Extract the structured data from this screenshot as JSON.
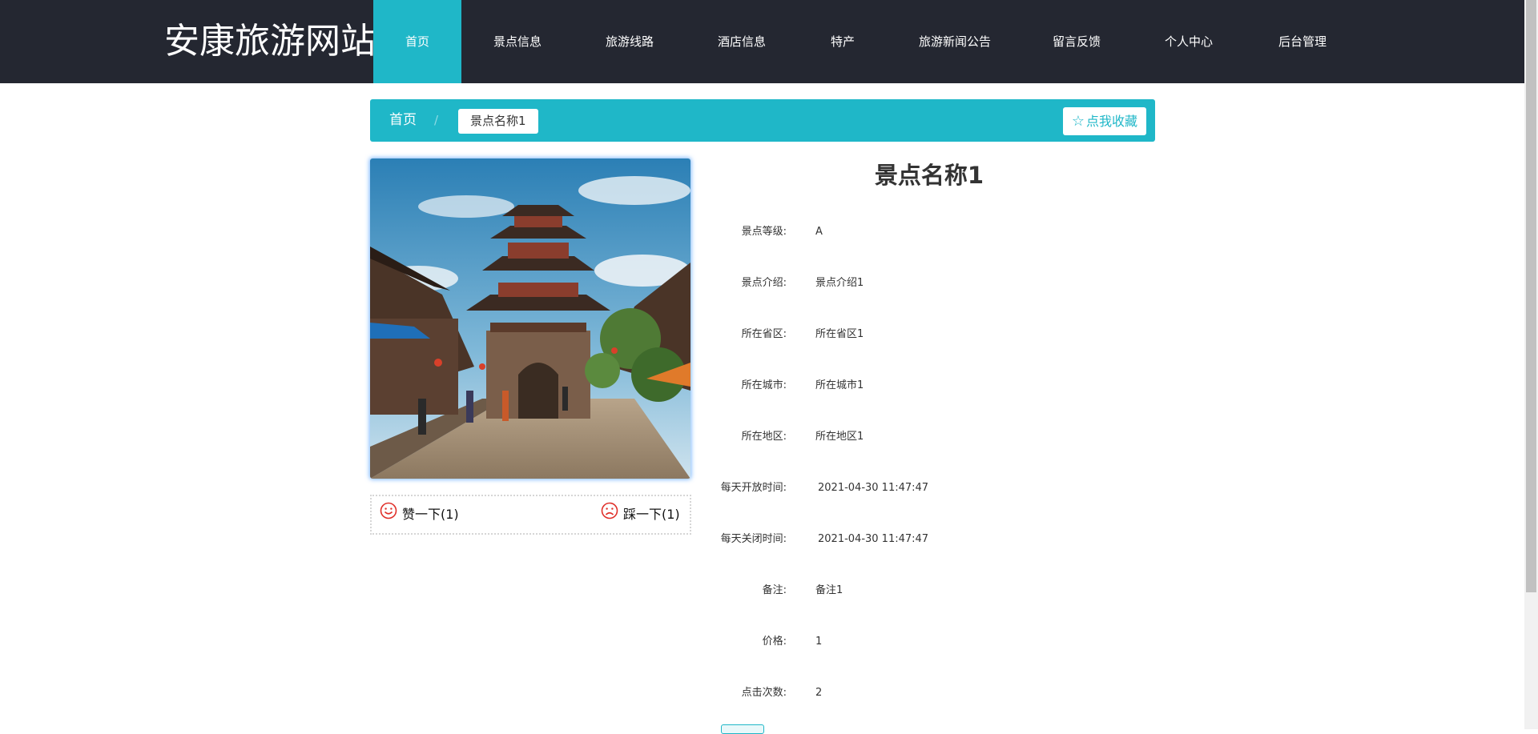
{
  "site": {
    "title": "安康旅游网站"
  },
  "nav": [
    {
      "label": "首页",
      "active": true
    },
    {
      "label": "景点信息"
    },
    {
      "label": "旅游线路"
    },
    {
      "label": "酒店信息"
    },
    {
      "label": "特产"
    },
    {
      "label": "旅游新闻公告"
    },
    {
      "label": "留言反馈"
    },
    {
      "label": "个人中心"
    },
    {
      "label": "后台管理"
    }
  ],
  "breadcrumb": {
    "home": "首页",
    "separator": "/",
    "current": "景点名称1"
  },
  "favorite": {
    "icon": "star-outline-icon",
    "label": "点我收藏"
  },
  "vote": {
    "like_label": "赞一下(1)",
    "dislike_label": "踩一下(1)",
    "like_icon": "smile-icon",
    "dislike_icon": "frown-icon"
  },
  "detail": {
    "title": "景点名称1",
    "fields": [
      {
        "label": "景点等级:",
        "value": "A"
      },
      {
        "label": "景点介绍:",
        "value": "景点介绍1"
      },
      {
        "label": "所在省区:",
        "value": "所在省区1"
      },
      {
        "label": "所在城市:",
        "value": "所在城市1"
      },
      {
        "label": "所在地区:",
        "value": "所在地区1"
      },
      {
        "label": "每天开放时间:",
        "value": "2021-04-30 11:47:47"
      },
      {
        "label": "每天关闭时间:",
        "value": "2021-04-30 11:47:47"
      },
      {
        "label": "备注:",
        "value": "备注1"
      },
      {
        "label": "价格:",
        "value": "1"
      },
      {
        "label": "点击次数:",
        "value": "2"
      }
    ]
  },
  "colors": {
    "accent": "#1fb7c8",
    "header_bg": "#242731",
    "vote_icon": "#e0302a"
  }
}
